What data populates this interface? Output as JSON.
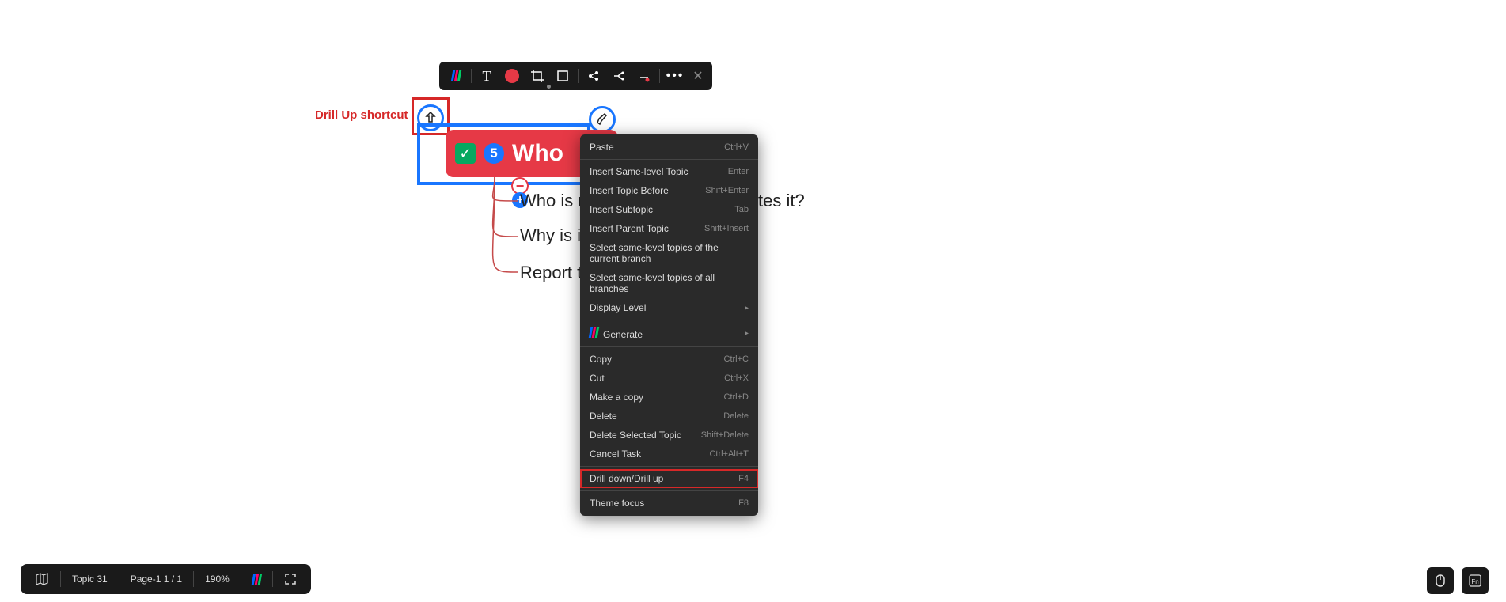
{
  "annotation": {
    "drill_up_label": "Drill Up shortcut"
  },
  "toolbar": {
    "icons": [
      "logo",
      "text",
      "record",
      "crop",
      "rect",
      "share",
      "branch",
      "marker",
      "more",
      "close"
    ]
  },
  "topic": {
    "number": "5",
    "title": "Who"
  },
  "subtopics": [
    "Who is r",
    "Why is it",
    "Report t"
  ],
  "subtopics_suffix": "tes it?",
  "context_menu": {
    "items": [
      {
        "label": "Paste",
        "shortcut": "Ctrl+V"
      },
      {
        "sep": true
      },
      {
        "label": "Insert Same-level Topic",
        "shortcut": "Enter"
      },
      {
        "label": "Insert Topic Before",
        "shortcut": "Shift+Enter"
      },
      {
        "label": "Insert Subtopic",
        "shortcut": "Tab"
      },
      {
        "label": "Insert Parent Topic",
        "shortcut": "Shift+Insert"
      },
      {
        "label": "Select same-level topics of the current branch",
        "shortcut": ""
      },
      {
        "label": "Select same-level topics of all branches",
        "shortcut": ""
      },
      {
        "label": "Display Level",
        "submenu": true
      },
      {
        "sep": true
      },
      {
        "label": "Generate",
        "submenu": true,
        "icon": true
      },
      {
        "sep": true
      },
      {
        "label": "Copy",
        "shortcut": "Ctrl+C"
      },
      {
        "label": "Cut",
        "shortcut": "Ctrl+X"
      },
      {
        "label": "Make a copy",
        "shortcut": "Ctrl+D"
      },
      {
        "label": "Delete",
        "shortcut": "Delete"
      },
      {
        "label": "Delete Selected Topic",
        "shortcut": "Shift+Delete"
      },
      {
        "label": "Cancel Task",
        "shortcut": "Ctrl+Alt+T"
      },
      {
        "sep": true
      },
      {
        "label": "Drill down/Drill up",
        "shortcut": "F4",
        "highlighted": true
      },
      {
        "sep": true
      },
      {
        "label": "Theme focus",
        "shortcut": "F8"
      }
    ]
  },
  "status": {
    "topic": "Topic 31",
    "page": "Page-1  1 / 1",
    "zoom": "190%"
  }
}
